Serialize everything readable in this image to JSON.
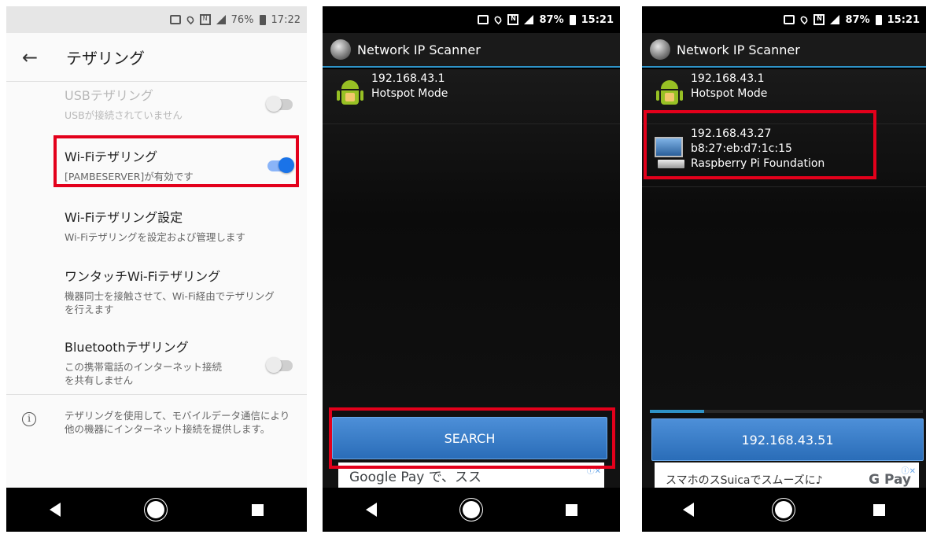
{
  "phone1": {
    "status": {
      "battery": "76%",
      "time": "17:22"
    },
    "title": "テザリング",
    "settings": [
      {
        "title": "USBテザリング",
        "subtitle": "USBが接続されていません",
        "state": "off",
        "enabled": false
      },
      {
        "title": "Wi-Fiテザリング",
        "subtitle": "[PAMBESERVER]が有効です",
        "state": "on",
        "enabled": true
      },
      {
        "title": "Wi-Fiテザリング設定",
        "subtitle": "Wi-Fiテザリングを設定および管理します"
      },
      {
        "title": "ワンタッチWi-Fiテザリング",
        "subtitle": "機器同士を接触させて、Wi-Fi経由でテザリングを行えます"
      },
      {
        "title": "Bluetoothテザリング",
        "subtitle": "この携帯電話のインターネット接続を共有しません",
        "state": "off",
        "enabled": true
      }
    ],
    "info": "テザリングを使用して、モバイルデータ通信により他の機器にインターネット接続を提供します。"
  },
  "phone2": {
    "status": {
      "battery": "87%",
      "time": "15:21"
    },
    "app_title": "Network IP Scanner",
    "devices": [
      {
        "ip": "192.168.43.1",
        "label": "Hotspot Mode"
      }
    ],
    "button": "SEARCH",
    "ad": "Google Pay で、スス"
  },
  "phone3": {
    "status": {
      "battery": "87%",
      "time": "15:21"
    },
    "app_title": "Network IP Scanner",
    "devices": [
      {
        "ip": "192.168.43.1",
        "label": "Hotspot Mode"
      },
      {
        "ip": "192.168.43.27",
        "mac": "b8:27:eb:d7:1c:15",
        "vendor": "Raspberry Pi Foundation"
      }
    ],
    "progress": 0.2,
    "button": "192.168.43.51",
    "ad": "スマホのスSuicaでスムーズに♪",
    "ad_brand": "G Pay"
  },
  "colors": {
    "highlight": "#e3001b",
    "accent": "#2e93c7",
    "switch_on": "#1a73e8",
    "android": "#97c024"
  }
}
